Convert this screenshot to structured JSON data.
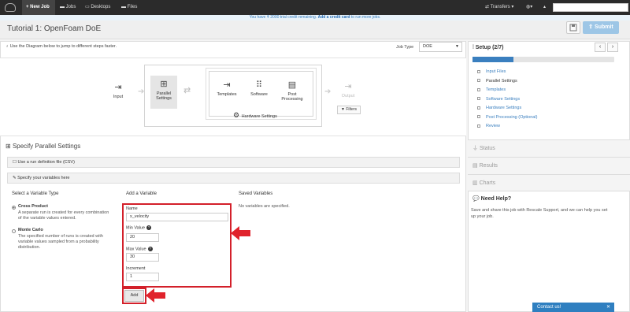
{
  "nav": {
    "new_job": "+ New Job",
    "jobs": "Jobs",
    "desktops": "Desktops",
    "files": "Files",
    "transfers": "Transfers ▾",
    "globe": "▾"
  },
  "banner": {
    "text": "You have ₹ 2000 trial credit remaining.",
    "link": "Add a credit card",
    "suffix": "to run more jobs."
  },
  "page": {
    "title": "Tutorial 1: OpenFoam DoE",
    "submit_label": "Submit",
    "hint": "Use the Diagram below to jump to different steps faster.",
    "job_type_label": "Job Type",
    "job_type_value": "DOE"
  },
  "diagram": {
    "input": "Input",
    "parallel_1": "Parallel",
    "parallel_2": "Settings",
    "templates": "Templates",
    "software": "Software",
    "post_1": "Post",
    "post_2": "Processing",
    "hardware": "Hardware Settings",
    "output": "Output",
    "filters": "Filters"
  },
  "section": {
    "title": "Specify Parallel Settings",
    "run_def": "Use a run definition file (CSV)",
    "specify_vars": "Specify your variables here"
  },
  "variable_type": {
    "heading": "Select a Variable Type",
    "cross_title": "Cross Product",
    "cross_desc_1": "A separate run is created for every combination",
    "cross_desc_2": "of the variable values entered.",
    "monte_title": "Monte Carlo",
    "monte_desc_1": "The specified number of runs is created with",
    "monte_desc_2": "variable values sampled from a probability",
    "monte_desc_3": "distribution."
  },
  "add_variable": {
    "heading": "Add a Variable",
    "name_label": "Name",
    "name_value": "x_velocity",
    "min_label": "Min Value",
    "min_value": "20",
    "max_label": "Max Value",
    "max_value": "30",
    "inc_label": "Increment",
    "inc_value": "1",
    "add_label": "Add"
  },
  "saved": {
    "heading": "Saved Variables",
    "empty": "No variables are specified."
  },
  "sidebar": {
    "setup": "Setup (2/7)",
    "progress_fraction": 0.29,
    "steps": [
      {
        "label": "Input Files",
        "active": false
      },
      {
        "label": "Parallel Settings",
        "active": true
      },
      {
        "label": "Templates",
        "active": false
      },
      {
        "label": "Software Settings",
        "active": false
      },
      {
        "label": "Hardware Settings",
        "active": false
      },
      {
        "label": "Post Processing (Optional)",
        "active": false
      },
      {
        "label": "Review",
        "active": false
      }
    ],
    "status": "Status",
    "results": "Results",
    "charts": "Charts",
    "need_help": "Need Help?",
    "help_1": "Save and share this job with Rescale Support, and we can help you set",
    "help_2": "up your job.",
    "contact": "Contact us!"
  },
  "colors": {
    "accent": "#3a7fbf",
    "highlight": "#d3202a",
    "nav": "#2b2b2b"
  }
}
